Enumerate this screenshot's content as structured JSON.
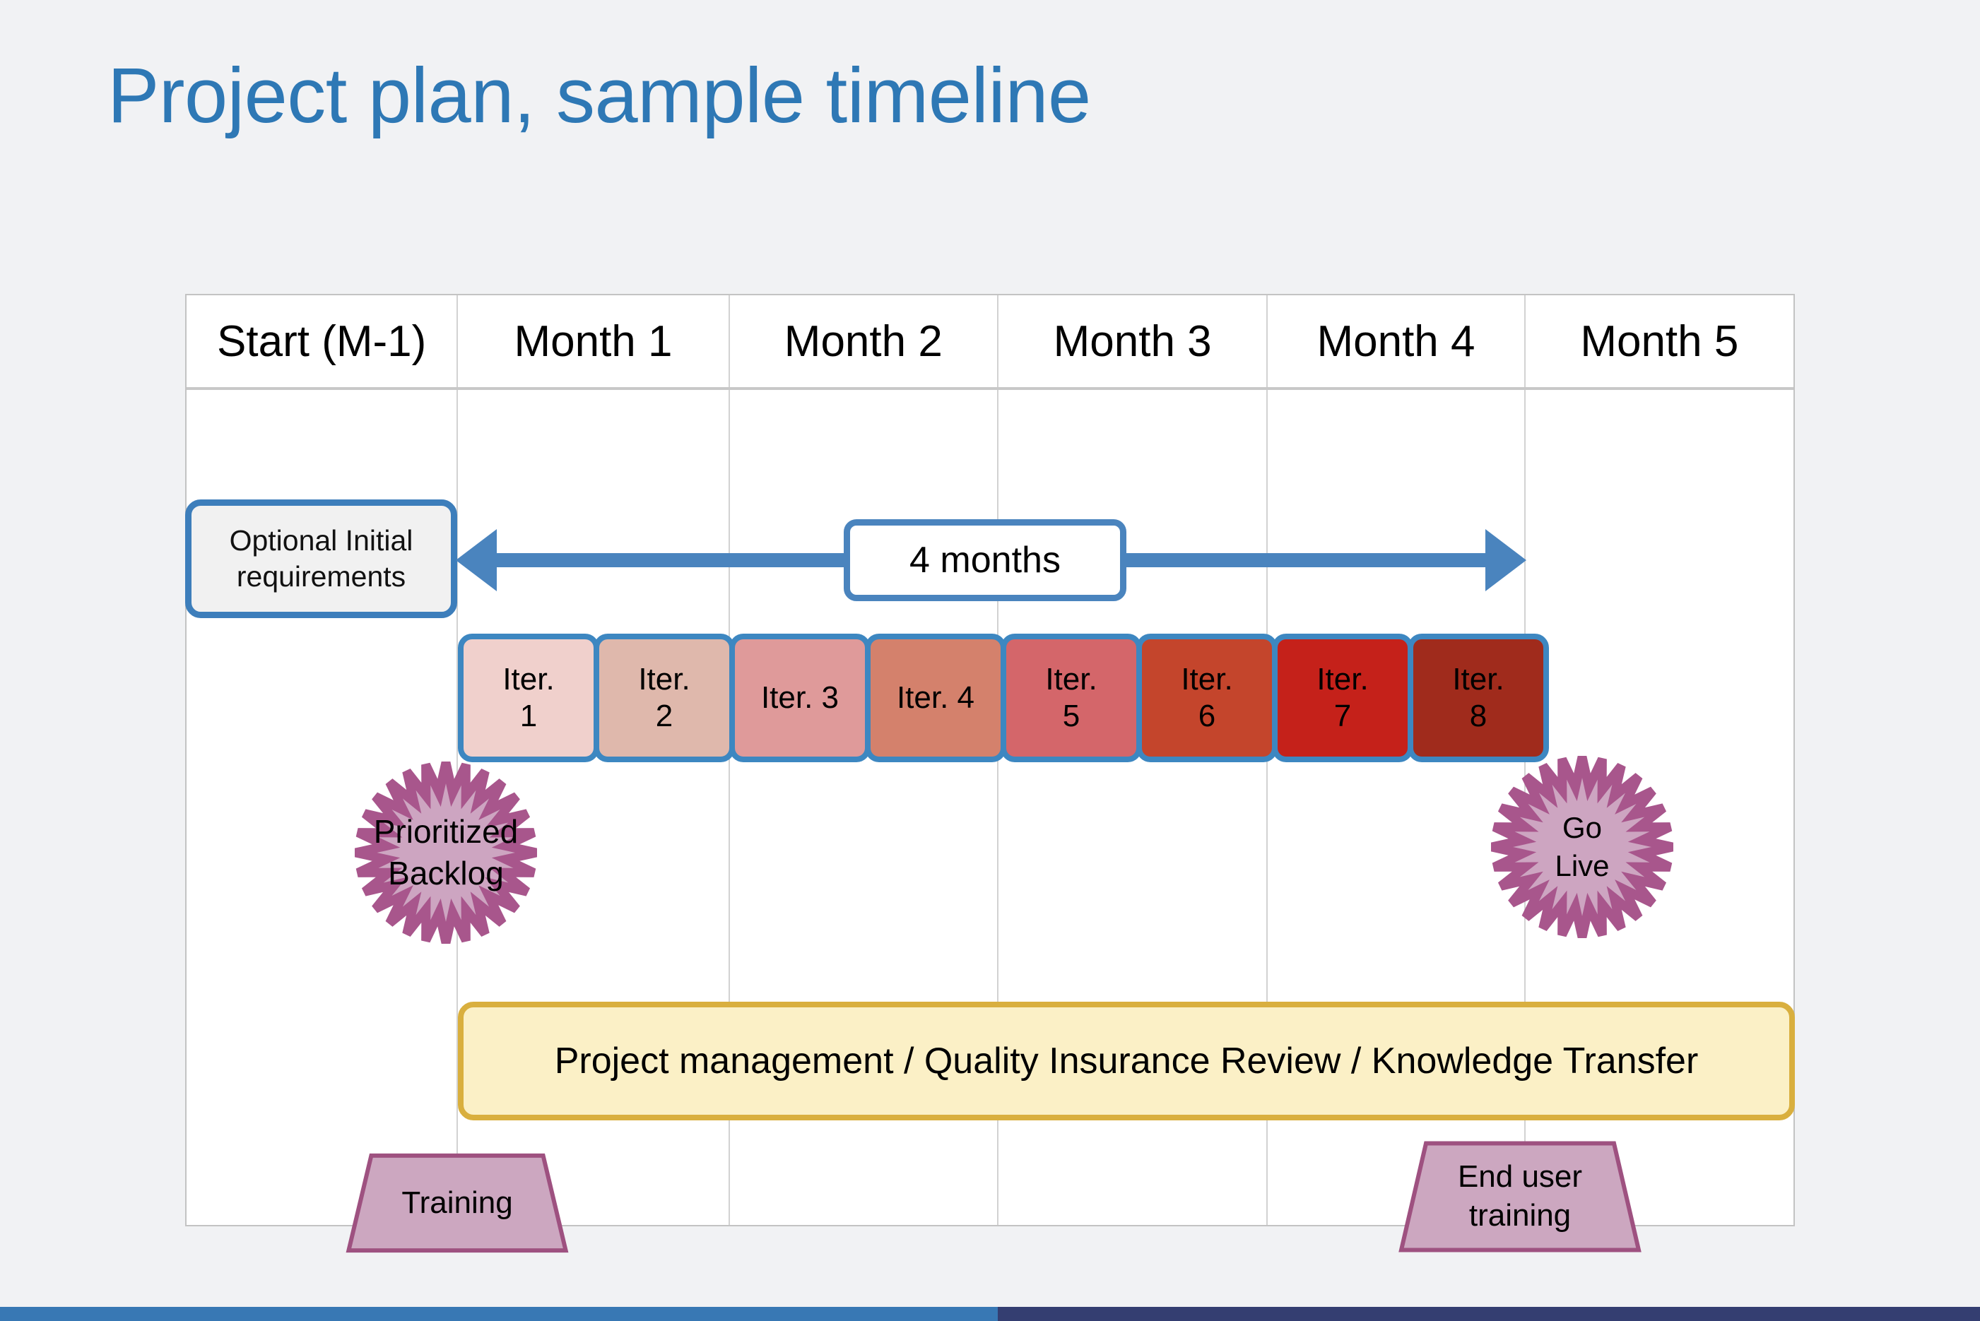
{
  "slide": {
    "title": "Project plan, sample timeline",
    "title_color": "#2E78B5",
    "background_color": "#F1F2F4"
  },
  "timeline": {
    "columns": [
      {
        "label": "Start (M-1)"
      },
      {
        "label": "Month 1"
      },
      {
        "label": "Month 2"
      },
      {
        "label": "Month 3"
      },
      {
        "label": "Month 4"
      },
      {
        "label": "Month 5"
      }
    ]
  },
  "requirements_box": {
    "line1": "Optional Initial",
    "line2": "requirements",
    "border_color": "#3D7EBB",
    "fill_color": "#F1F1F1"
  },
  "duration_arrow": {
    "label": "4 months",
    "color": "#4A84BE"
  },
  "iterations": {
    "border_color": "#3D87C1",
    "items": [
      {
        "line1": "Iter.",
        "line2": "1",
        "single": "",
        "fill": "#F0D0CC",
        "two_line": true
      },
      {
        "line1": "Iter.",
        "line2": "2",
        "single": "",
        "fill": "#DFB8AC",
        "two_line": true
      },
      {
        "line1": "",
        "line2": "",
        "single": "Iter. 3",
        "fill": "#DF9A9A",
        "two_line": false
      },
      {
        "line1": "",
        "line2": "",
        "single": "Iter. 4",
        "fill": "#D4816C",
        "two_line": false
      },
      {
        "line1": "Iter.",
        "line2": "5",
        "single": "",
        "fill": "#D4666A",
        "two_line": true
      },
      {
        "line1": "Iter.",
        "line2": "6",
        "single": "",
        "fill": "#C4452C",
        "two_line": true
      },
      {
        "line1": "Iter.",
        "line2": "7",
        "single": "",
        "fill": "#C5211A",
        "two_line": true
      },
      {
        "line1": "Iter.",
        "line2": "8",
        "single": "",
        "fill": "#A02B1C",
        "two_line": true
      }
    ]
  },
  "milestones": {
    "fill_color": "#CDA5C1",
    "point_color": "#A8568C",
    "backlog": {
      "line1": "Prioritized",
      "line2": "Backlog"
    },
    "go_live": {
      "line1": "Go",
      "line2": "Live"
    }
  },
  "pm_banner": {
    "text": "Project management / Quality Insurance Review / Knowledge Transfer",
    "fill_color": "#FBF0C6",
    "border_color": "#D9AF3E"
  },
  "training": {
    "fill_color": "#CCA7C0",
    "border_color": "#9E5180",
    "early": {
      "line1": "Training",
      "line2": ""
    },
    "end_user": {
      "line1": "End user",
      "line2": "training"
    }
  },
  "footer": {
    "left_color": "#3878B4",
    "right_color": "#343E71"
  }
}
